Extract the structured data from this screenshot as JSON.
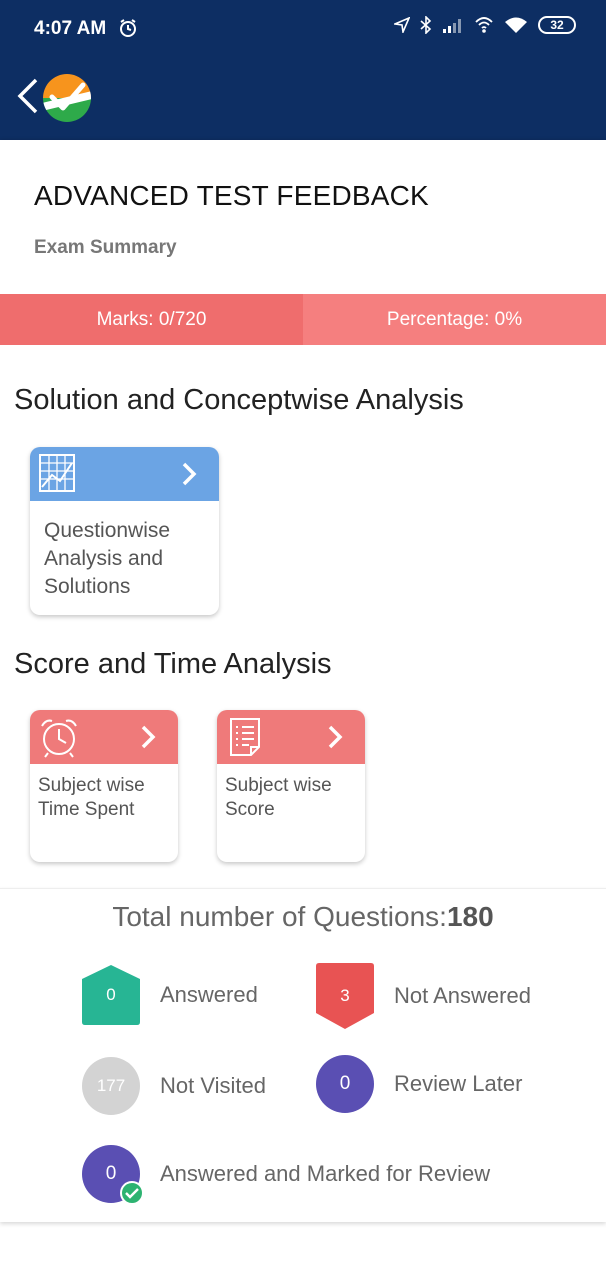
{
  "status_bar": {
    "time": "4:07 AM",
    "battery": "32",
    "icons": [
      "alarm-icon",
      "location-icon",
      "bluetooth-icon",
      "signal-icon",
      "hotspot-icon",
      "wifi-icon",
      "battery-icon"
    ]
  },
  "app_bar": {
    "icons": [
      "back-icon",
      "logo-check-icon"
    ]
  },
  "header": {
    "title": "ADVANCED TEST FEEDBACK",
    "subtitle": "Exam Summary"
  },
  "summary": {
    "marks": "Marks: 0/720",
    "percentage": "Percentage: 0%"
  },
  "sections": {
    "solution_title": "Solution and Conceptwise Analysis",
    "score_title": "Score and Time Analysis"
  },
  "cards": {
    "questionwise": "Questionwise Analysis and Solutions",
    "time_spent": "Subject wise Time Spent",
    "score": "Subject wise Score"
  },
  "legend": {
    "total_label": "Total number of Questions:",
    "total_value": "180",
    "answered_count": "0",
    "answered_label": "Answered",
    "not_answered_count": "3",
    "not_answered_label": "Not Answered",
    "not_visited_count": "177",
    "not_visited_label": "Not Visited",
    "review_later_count": "0",
    "review_later_label": "Review Later",
    "answered_marked_count": "0",
    "answered_marked_label": "Answered and Marked for Review"
  },
  "colors": {
    "app_bar": "#0d2e63",
    "marks_bg": "#ef6d6d",
    "percentage_bg": "#f57f7f",
    "card_blue": "#6ba4e4",
    "card_red": "#ef7a7a",
    "answered": "#27b594",
    "not_answered": "#e85353",
    "not_visited": "#d3d3d3",
    "review": "#5a4fb3"
  }
}
